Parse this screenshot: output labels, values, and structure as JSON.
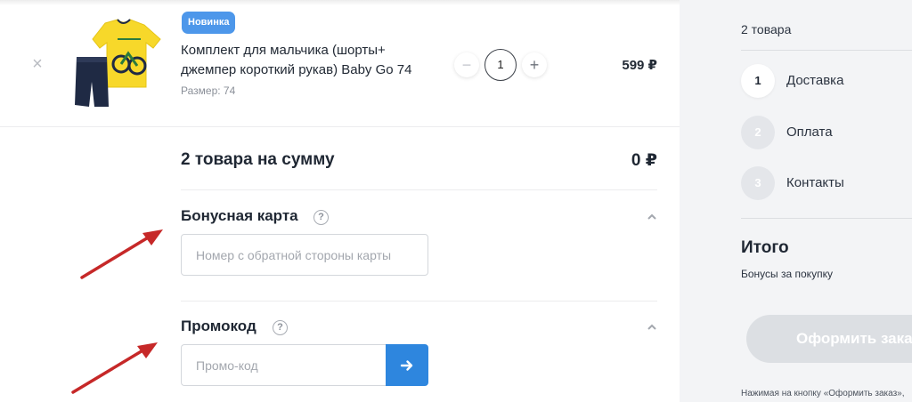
{
  "product": {
    "badge": "Новинка",
    "title": "Комплект для мальчика (шорты+ джемпер короткий рукав) Baby Go 74",
    "size": "Размер: 74",
    "quantity": "1",
    "minus_label": "−",
    "plus_label": "+",
    "price": "599 ₽",
    "remove_label": "×"
  },
  "summary": {
    "label": "2 товара на сумму",
    "value": "0 ₽"
  },
  "bonus_card": {
    "title": "Бонусная карта",
    "help": "?",
    "placeholder": "Номер с обратной стороны карты"
  },
  "promo": {
    "title": "Промокод",
    "help": "?",
    "placeholder": "Промо-код"
  },
  "sidebar": {
    "count": "2 товара",
    "steps": [
      {
        "number": "1",
        "label": "Доставка"
      },
      {
        "number": "2",
        "label": "Оплата"
      },
      {
        "number": "3",
        "label": "Контакты"
      }
    ],
    "total_label": "Итого",
    "bonus_label": "Бонусы за покупку",
    "order_button": "Оформить заказ",
    "note": "Нажимая на кнопку «Оформить заказ»,"
  },
  "colors": {
    "accent": "#2e86de",
    "badge": "#4d97ea",
    "annotation_arrow": "#c62828",
    "sidebar_bg": "#f3f4f6"
  }
}
